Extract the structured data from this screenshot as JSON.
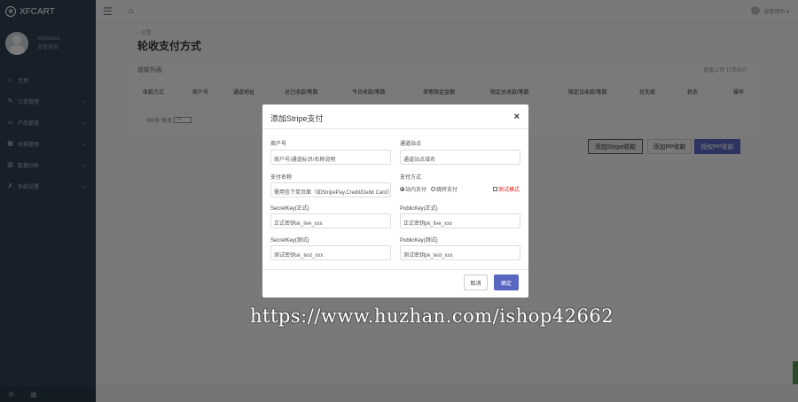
{
  "brand": {
    "name": "XFCART"
  },
  "profile": {
    "welcome": "Welcome,",
    "role": "总管理员"
  },
  "sidebar": {
    "items": [
      {
        "label": "主页",
        "icon": "home-icon",
        "glyph": "⌂",
        "chevron": false
      },
      {
        "label": "订单管理",
        "icon": "edit-icon",
        "glyph": "✎",
        "chevron": true
      },
      {
        "label": "产品管理",
        "icon": "desktop-icon",
        "glyph": "▭",
        "chevron": true
      },
      {
        "label": "价格管理",
        "icon": "table-icon",
        "glyph": "▦",
        "chevron": true
      },
      {
        "label": "数据分析",
        "icon": "bar-chart-icon",
        "glyph": "▥",
        "chevron": true
      },
      {
        "label": "系统设置",
        "icon": "wrench-icon",
        "glyph": "✗",
        "chevron": true
      }
    ]
  },
  "topbar": {
    "user": "总管理员 ▾"
  },
  "page": {
    "breadcrumb": "‹ 设置",
    "title": "轮收支付方式",
    "panel_title": "收款列表",
    "panel_links": "批量上传 订单统计",
    "columns": [
      "收款方式",
      "商户号",
      "通道地址",
      "总已收款/笔数",
      "今日收款/笔数",
      "单笔限定金额",
      "限定总收款/笔数",
      "限定日收款/笔数",
      "优先级",
      "状态",
      "操作"
    ],
    "pager_prefix": "共0条 每页",
    "pager_value": "10",
    "btn_stripe": "添加Stripe收款",
    "btn_pp": "添加PP收款",
    "btn_auth": "授权PP收款"
  },
  "watermark": "https://www.huzhan.com/ishop42662",
  "modal": {
    "title": "添加Stripe支付",
    "close": "×",
    "merchant_label": "商户号",
    "merchant_value": "商户号/通道标识/名称说明",
    "channel_label": "通道站点",
    "channel_value": "通道站点域名",
    "pay_name_label": "支付名称",
    "pay_name_value": "需用信下单页面（如StripePay,Credit/Debit Card）",
    "pay_mode_label": "支付方式",
    "pay_mode_option1": "站内支付",
    "pay_mode_option2": "跳转支付",
    "pay_mode_check": "测试模式",
    "secret_live_label": "SecretKey(正式)",
    "secret_live_value": "正式密钥sk_live_xxx",
    "public_live_label": "PublicKey(正式)",
    "public_live_value": "正式密钥pk_live_xxx",
    "secret_test_label": "SecretKey(测试)",
    "secret_test_value": "测试密钥sk_test_xxx",
    "public_test_label": "PublicKey(测试)",
    "public_test_value": "测试密钥pk_test_xxx",
    "cancel": "取消",
    "ok": "确定"
  }
}
